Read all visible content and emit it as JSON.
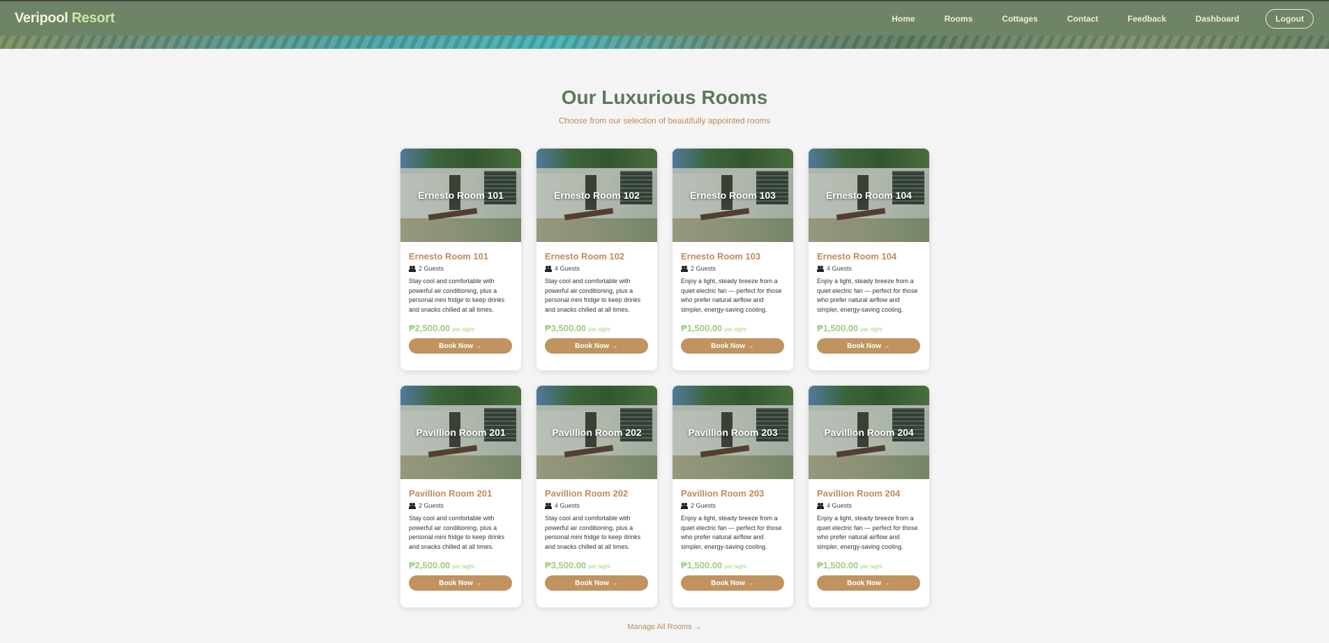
{
  "header": {
    "brand_main": "Veripool",
    "brand_accent": "Resort",
    "nav": [
      "Home",
      "Rooms",
      "Cottages",
      "Contact",
      "Feedback",
      "Dashboard"
    ],
    "logout": "Logout"
  },
  "section": {
    "title": "Our Luxurious Rooms",
    "subtitle": "Choose from our selection of beautifully appointed rooms"
  },
  "rooms": [
    {
      "name": "Ernesto Room 101",
      "guests": "2 Guests",
      "description": "Stay cool and comfortable with powerful air conditioning, plus a personal mini fridge to keep drinks and snacks chilled at all times.",
      "price": "₱2,500.00",
      "per_night": "per night",
      "button": "Book Now →"
    },
    {
      "name": "Ernesto Room 102",
      "guests": "4 Guests",
      "description": "Stay cool and comfortable with powerful air conditioning, plus a personal mini fridge to keep drinks and snacks chilled at all times.",
      "price": "₱3,500.00",
      "per_night": "per night",
      "button": "Book Now →"
    },
    {
      "name": "Ernesto Room 103",
      "guests": "2 Guests",
      "description": "Enjoy a light, steady breeze from a quiet electric fan — perfect for those who prefer natural airflow and simpler, energy-saving cooling.",
      "price": "₱1,500.00",
      "per_night": "per night",
      "button": "Book Now →"
    },
    {
      "name": "Ernesto Room 104",
      "guests": "4 Guests",
      "description": "Enjoy a light, steady breeze from a quiet electric fan — perfect for those who prefer natural airflow and simpler, energy-saving cooling.",
      "price": "₱1,500.00",
      "per_night": "per night",
      "button": "Book Now →"
    },
    {
      "name": "Pavillion Room 201",
      "guests": "2 Guests",
      "description": "Stay cool and comfortable with powerful air conditioning, plus a personal mini fridge to keep drinks and snacks chilled at all times.",
      "price": "₱2,500.00",
      "per_night": "per night",
      "button": "Book Now →"
    },
    {
      "name": "Pavillion Room 202",
      "guests": "4 Guests",
      "description": "Stay cool and comfortable with powerful air conditioning, plus a personal mini fridge to keep drinks and snacks chilled at all times.",
      "price": "₱3,500.00",
      "per_night": "per night",
      "button": "Book Now →"
    },
    {
      "name": "Pavillion Room 203",
      "guests": "2 Guests",
      "description": "Enjoy a light, steady breeze from a quiet electric fan — perfect for those who prefer natural airflow and simpler, energy-saving cooling.",
      "price": "₱1,500.00",
      "per_night": "per night",
      "button": "Book Now →"
    },
    {
      "name": "Pavillion Room 204",
      "guests": "4 Guests",
      "description": "Enjoy a light, steady breeze from a quiet electric fan — perfect for those who prefer natural airflow and simpler, energy-saving cooling.",
      "price": "₱1,500.00",
      "per_night": "per night",
      "button": "Book Now →"
    }
  ],
  "footer": {
    "manage_link": "Manage All Rooms →"
  },
  "colors": {
    "navbar": "#6e8466",
    "title": "#5b7a5a",
    "accent": "#c08a5a",
    "price": "#9ccc7f",
    "button": "#c0935f"
  }
}
